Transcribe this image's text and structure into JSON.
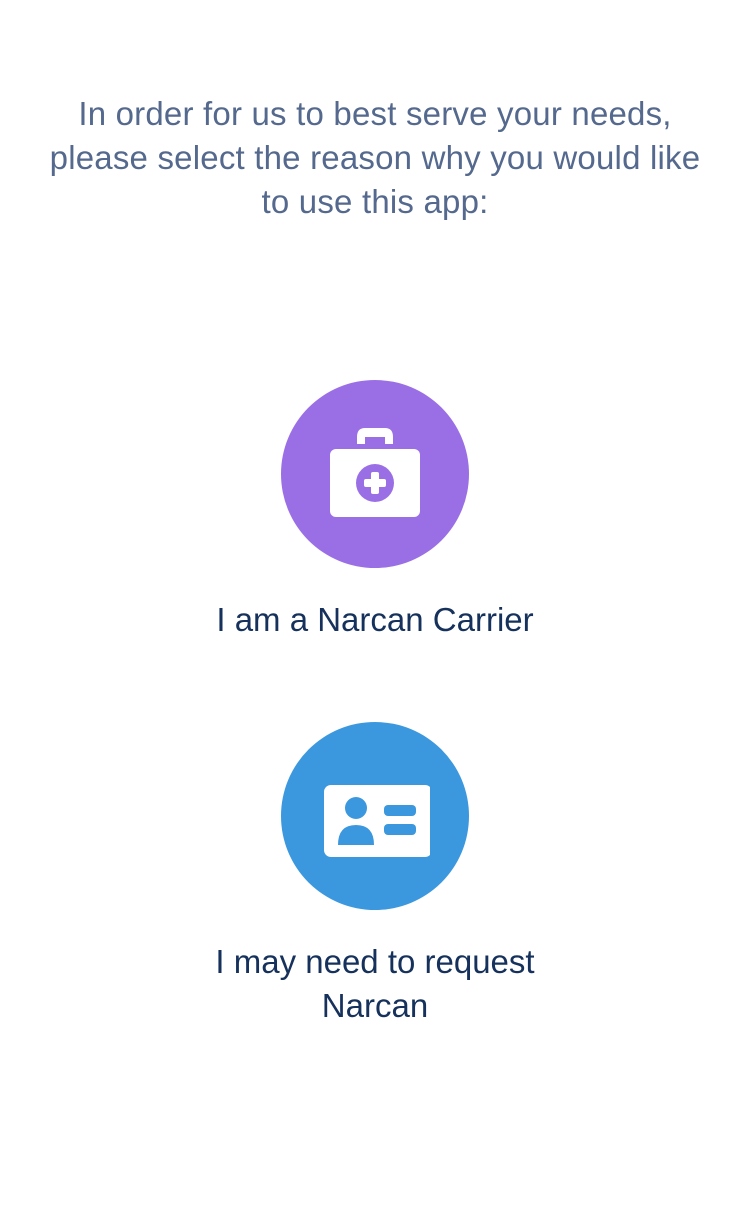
{
  "intro": {
    "text": "In order for us to best serve your needs, please select the reason why you would like to use this app:"
  },
  "options": [
    {
      "label": "I am a Narcan Carrier",
      "icon": "first-aid-kit-icon",
      "color": "#9a6fe6"
    },
    {
      "label": "I may need to request Narcan",
      "icon": "contact-card-icon",
      "color": "#3c98de"
    }
  ],
  "colors": {
    "intro_text": "#54698d",
    "label_text": "#16325c",
    "background": "#ffffff"
  }
}
